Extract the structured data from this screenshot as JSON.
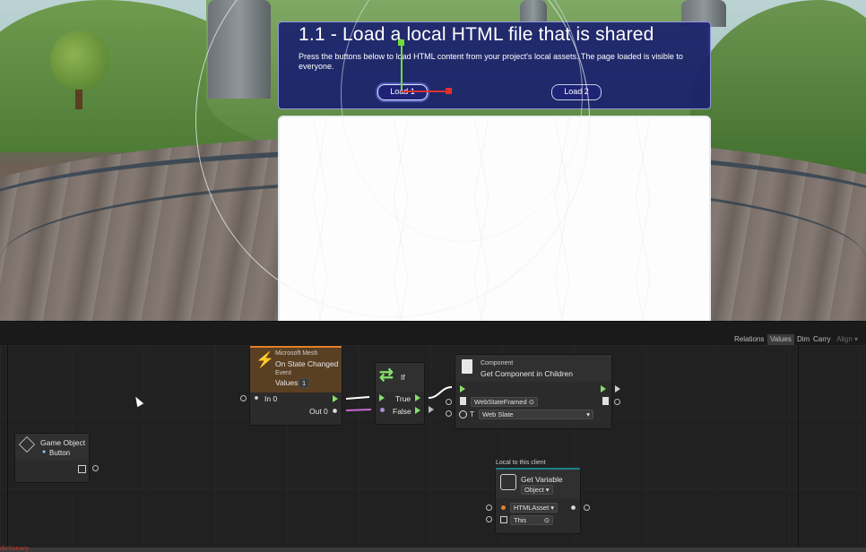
{
  "viewport": {
    "panel_title": "1.1 - Load a local HTML file that is shared",
    "panel_description": "Press the buttons below to load HTML content from your project's local assets. The page loaded is visible to everyone.",
    "button1_label": "Load 1",
    "button2_label": "Load 2"
  },
  "graph_toolbar": {
    "relations": "Relations",
    "values": "Values",
    "dim": "Dim",
    "carry": "Carry",
    "align": "Align ▾"
  },
  "nodes": {
    "state_event": {
      "category": "Microsoft Mesh",
      "title": "On State Changed",
      "subtitle": "Event",
      "values_label": "Values",
      "values_count": "1",
      "in_label": "In 0",
      "out_label": "Out 0"
    },
    "if_node": {
      "title": "If",
      "true_label": "True",
      "false_label": "False"
    },
    "component": {
      "category": "Component",
      "title": "Get Component in Children",
      "target": "WebStateFramed",
      "type": "Web Slate",
      "type_prefix": "T"
    },
    "game_object": {
      "title": "Game Object",
      "value": "Button"
    },
    "get_variable": {
      "scope_label": "Local to this client",
      "title": "Get Variable",
      "kind": "Object ▾",
      "var_name": "HTMLAsset",
      "source": "This"
    }
  },
  "status_text": "dictionary",
  "colors": {
    "panel_bg": "#161a6e",
    "event_node_accent": "#e0802a",
    "flow_green": "#86e06a",
    "get_variable_accent": "#1e7f86",
    "axis_x": "#e03030",
    "axis_y": "#6fdc3c"
  }
}
